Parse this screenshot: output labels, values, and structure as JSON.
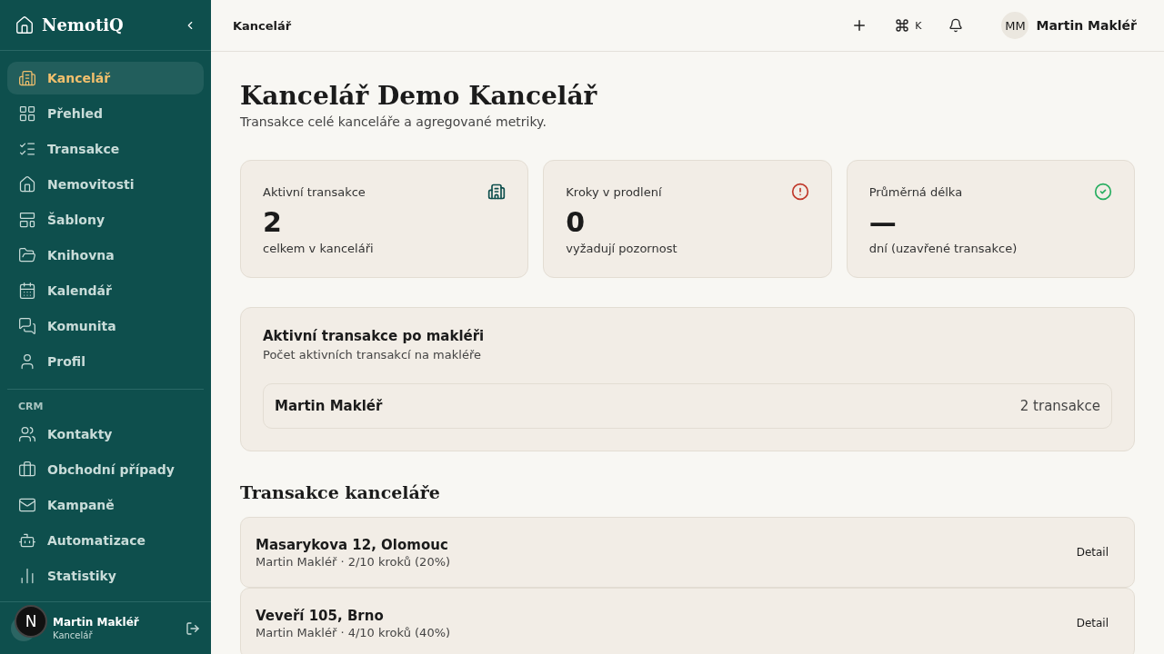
{
  "sidebar": {
    "logo": "NemotiQ",
    "nav": [
      {
        "label": "Kancelář",
        "selected": true
      },
      {
        "label": "Přehled",
        "selected": false
      },
      {
        "label": "Transakce",
        "selected": false
      },
      {
        "label": "Nemovitosti",
        "selected": false
      },
      {
        "label": "Šablony",
        "selected": false
      },
      {
        "label": "Knihovna",
        "selected": false
      },
      {
        "label": "Kalendář",
        "selected": false
      },
      {
        "label": "Komunita",
        "selected": false
      },
      {
        "label": "Profil",
        "selected": false
      }
    ],
    "crm_heading": "CRM",
    "crm": [
      {
        "label": "Kontakty",
        "selected": false
      },
      {
        "label": "Obchodní případy",
        "selected": false
      },
      {
        "label": "Kampaně",
        "selected": false
      },
      {
        "label": "Automatizace",
        "selected": false
      },
      {
        "label": "Statistiky",
        "selected": false
      }
    ],
    "user": {
      "name": "Martin Makléř",
      "role": "Kancelář"
    },
    "dev_badge": "N"
  },
  "topbar": {
    "breadcrumb": "Kancelář",
    "shortcut_key": "K",
    "user": {
      "initials": "MM",
      "name": "Martin Makléř"
    }
  },
  "page": {
    "title": "Kancelář Demo Kancelář",
    "subtitle": "Transakce celé kanceláře a agregované metriky."
  },
  "stats": [
    {
      "label": "Aktivní transakce",
      "value": "2",
      "note": "celkem v kanceláři"
    },
    {
      "label": "Kroky v prodlení",
      "value": "0",
      "note": "vyžadují pozornost"
    },
    {
      "label": "Průměrná délka",
      "value": "—",
      "note": "dní (uzavřené transakce)"
    }
  ],
  "by_agent": {
    "title": "Aktivní transakce po makléři",
    "subtitle": "Počet aktivních transakcí na makléře",
    "rows": [
      {
        "name": "Martin Makléř",
        "count": "2 transakce"
      }
    ]
  },
  "transactions": {
    "title": "Transakce kanceláře",
    "rows": [
      {
        "address": "Masarykova 12, Olomouc",
        "meta": "Martin Makléř · 2/10 kroků (20%)",
        "action": "Detail"
      },
      {
        "address": "Veveří 105, Brno",
        "meta": "Martin Makléř · 4/10 kroků (40%)",
        "action": "Detail"
      }
    ]
  }
}
